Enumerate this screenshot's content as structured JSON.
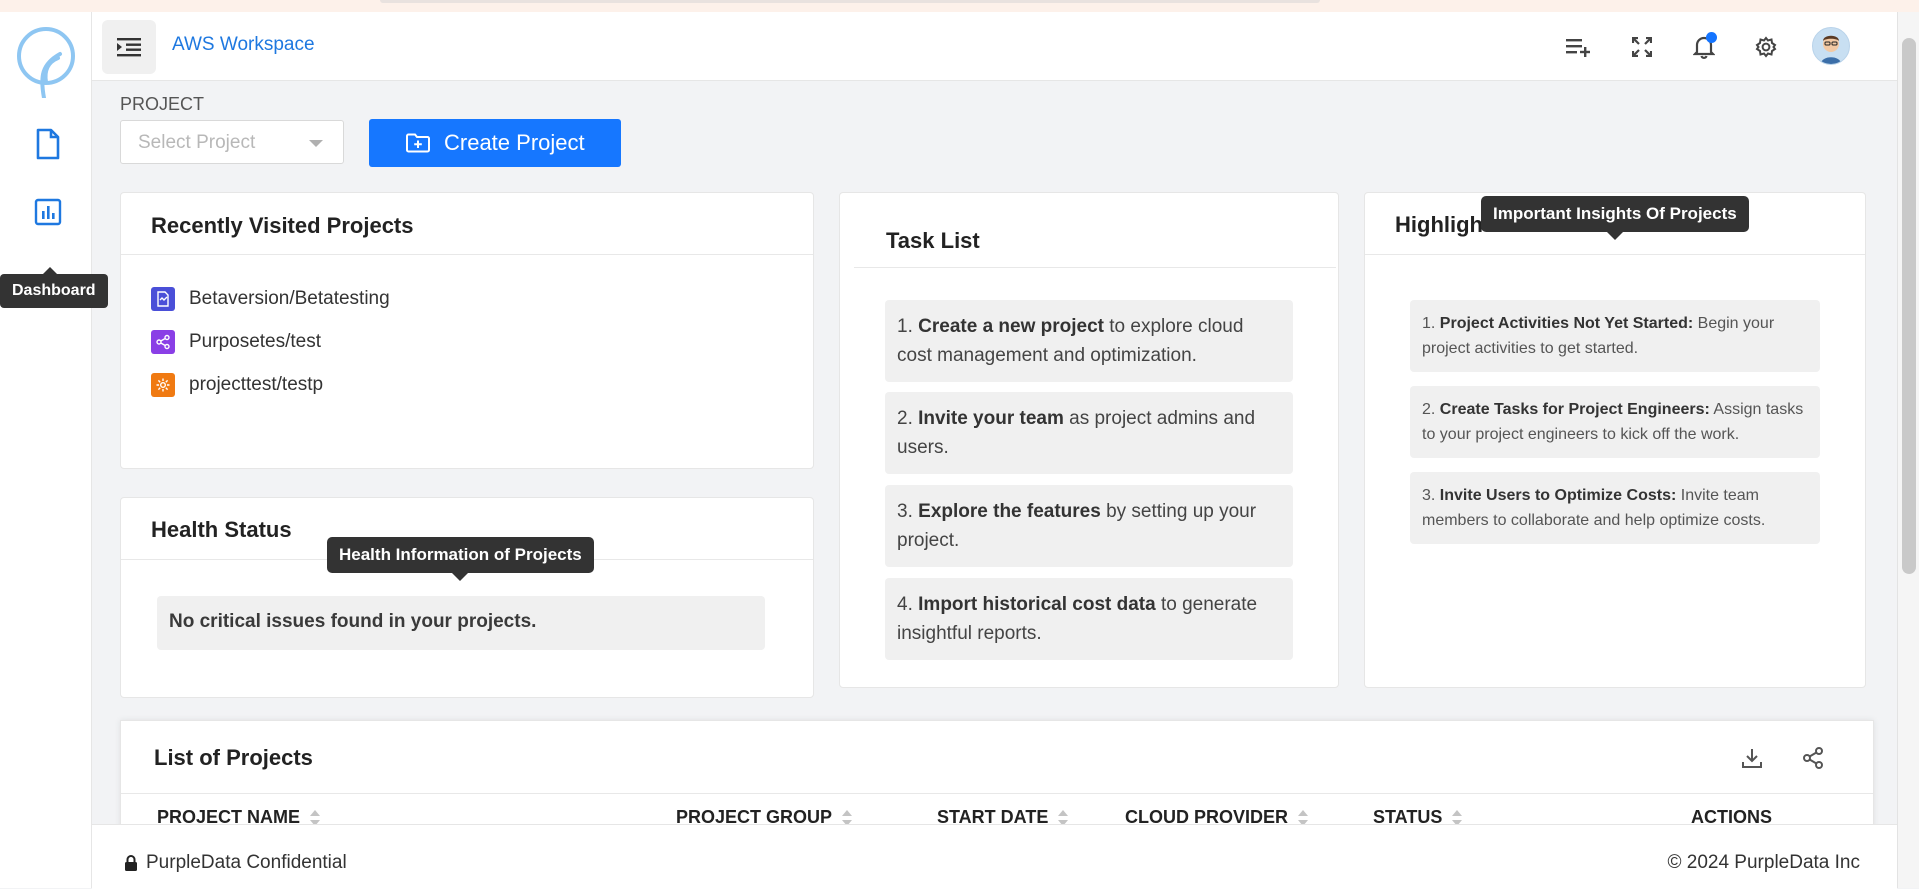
{
  "app": {
    "workspace_title": "AWS Workspace",
    "sidebar_tooltip": "Dashboard"
  },
  "project": {
    "label": "PROJECT",
    "select_placeholder": "Select Project",
    "create_button": "Create Project"
  },
  "recent": {
    "title": "Recently Visited Projects",
    "items": [
      {
        "label": "Betaversion/Betatesting",
        "icon": "document-chart-icon",
        "color": "#4a4fd8"
      },
      {
        "label": "Purposetes/test",
        "icon": "share-nodes-icon",
        "color": "#8a3fe6"
      },
      {
        "label": "projecttest/testp",
        "icon": "gear-badge-icon",
        "color": "#f07a12"
      }
    ]
  },
  "health": {
    "title": "Health Status",
    "tooltip": "Health Information of Projects",
    "message": "No critical issues found in your projects."
  },
  "tasks": {
    "title": "Task List",
    "items": [
      {
        "num": "1.",
        "bold": "Create a new project",
        "rest": " to explore cloud cost management and optimization."
      },
      {
        "num": "2.",
        "bold": "Invite your team",
        "rest": " as project admins and users."
      },
      {
        "num": "3.",
        "bold": "Explore the features",
        "rest": " by setting up your project."
      },
      {
        "num": "4.",
        "bold": "Import historical cost data",
        "rest": " to generate insightful reports."
      }
    ]
  },
  "highlights": {
    "title": "Highlights",
    "tooltip": "Important Insights Of Projects",
    "items": [
      {
        "num": "1.",
        "bold": "Project Activities Not Yet Started:",
        "rest": " Begin your project activities to get started."
      },
      {
        "num": "2.",
        "bold": "Create Tasks for Project Engineers:",
        "rest": " Assign tasks to your project engineers to kick off the work."
      },
      {
        "num": "3.",
        "bold": "Invite Users to Optimize Costs:",
        "rest": " Invite team members to collaborate and help optimize costs."
      }
    ]
  },
  "list": {
    "title": "List of Projects",
    "columns": [
      "PROJECT NAME",
      "PROJECT GROUP",
      "START DATE",
      "CLOUD PROVIDER",
      "STATUS",
      "ACTIONS"
    ]
  },
  "footer": {
    "left": "PurpleData Confidential",
    "right": "© 2024 PurpleData Inc"
  },
  "colors": {
    "accent": "#1677ff",
    "link": "#1e78e0",
    "notification_dot": "#1474ff"
  }
}
